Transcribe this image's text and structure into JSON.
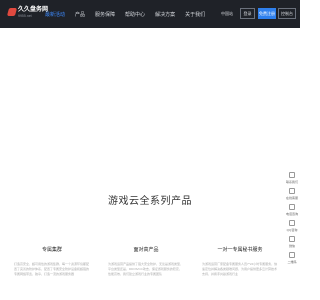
{
  "header": {
    "brand": "久久盘务网",
    "domain": "9955.net",
    "nav": [
      "最新活动",
      "产品",
      "服务保障",
      "帮助中心",
      "解决方案",
      "关于我们"
    ],
    "region": "中国站",
    "login": "登录",
    "register": "免费注册",
    "console": "控制台"
  },
  "main": {
    "section_title": "游戏云全系列产品"
  },
  "features": [
    {
      "title": "专属集群",
      "desc": "打造高安全、超可用性的游戏集群，每一个资源环境都配置了完善的防护体系，配置了专属安全防护设备和超强的专属网络带宽，独享，打造一流的游戏服务器"
    },
    {
      "title": "面对高产品",
      "desc": "为游戏运营产品提供了强大安全防护，无论是游戏类型、平台类型还是，DDOS/CC攻击，保证游戏服务的稳定，性能高效，我们建立游戏行业的专属团队"
    },
    {
      "title": "一对一专属秘书服务",
      "desc": "为游戏运营厂家配备专属服务人员7*24小时专属服务，快速定位并解决各类疑难问题，为用户提供更多云计算技术支持，并携手共赢游戏行业"
    }
  ],
  "float_bar": [
    "联系我们",
    "在线客服",
    "电话咨询",
    "QQ咨询",
    "微信",
    "二维码"
  ]
}
